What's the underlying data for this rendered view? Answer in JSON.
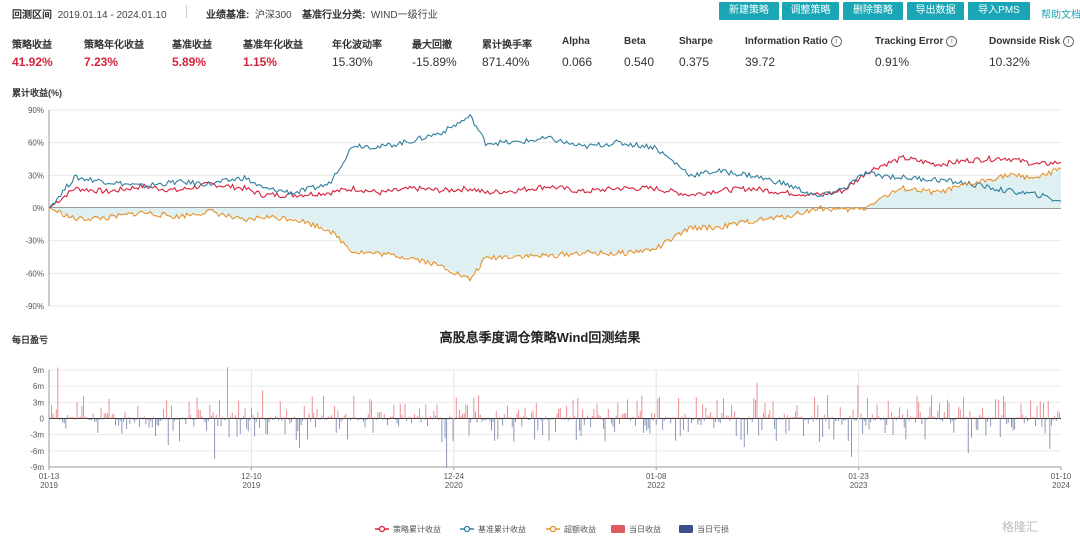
{
  "header": {
    "period_label": "回测区间",
    "period_value": "2019.01.14 - 2024.01.10",
    "benchmark_label": "业绩基准:",
    "benchmark_value": "沪深300",
    "industry_label": "基准行业分类:",
    "industry_value": "WIND一级行业",
    "buttons": [
      "新建策略",
      "调整策略",
      "删除策略",
      "导出数据",
      "导入PMS"
    ],
    "help": "帮助文档"
  },
  "metrics": [
    {
      "label": "策略收益",
      "value": "41.92%",
      "red": true
    },
    {
      "label": "策略年化收益",
      "value": "7.23%",
      "red": true
    },
    {
      "label": "基准收益",
      "value": "5.89%",
      "red": true
    },
    {
      "label": "基准年化收益",
      "value": "1.15%",
      "red": true
    },
    {
      "label": "年化波动率",
      "value": "15.30%",
      "red": false
    },
    {
      "label": "最大回撤",
      "value": "-15.89%",
      "red": false
    },
    {
      "label": "累计换手率",
      "value": "871.40%",
      "red": false
    },
    {
      "label": "Alpha",
      "value": "0.066",
      "red": false
    },
    {
      "label": "Beta",
      "value": "0.540",
      "red": false
    },
    {
      "label": "Sharpe",
      "value": "0.375",
      "red": false
    },
    {
      "label": "Information Ratio",
      "value": "39.72",
      "red": false,
      "info": true
    },
    {
      "label": "Tracking Error",
      "value": "0.91%",
      "red": false,
      "info": true
    },
    {
      "label": "Downside Risk",
      "value": "10.32%",
      "red": false,
      "info": true
    }
  ],
  "colors": {
    "button": "#1aa6b5",
    "strategy": "#d6233c",
    "benchmark": "#2f7f9e",
    "excess": "#e8922d",
    "daily_gain": "#e05a62",
    "daily_loss": "#3c4f86",
    "excess_fill": "#dff0f2"
  },
  "chart_data": [
    {
      "type": "line",
      "ylabel": "累计收益(%)",
      "ylim": [
        -90,
        90
      ],
      "yticks": [
        "90%",
        "60%",
        "30%",
        "0%",
        "-30%",
        "-60%",
        "-90%"
      ],
      "x": [
        "2019-01-14",
        "2019-03-01",
        "2019-05-01",
        "2019-07-01",
        "2019-09-01",
        "2019-11-01",
        "2020-01-01",
        "2020-02-03",
        "2020-04-01",
        "2020-06-01",
        "2020-07-15",
        "2020-09-01",
        "2020-11-01",
        "2020-12-24",
        "2021-02-10",
        "2021-02-18",
        "2021-03-10",
        "2021-05-01",
        "2021-07-01",
        "2021-09-01",
        "2021-11-01",
        "2022-01-08",
        "2022-03-15",
        "2022-05-01",
        "2022-07-01",
        "2022-09-01",
        "2022-10-31",
        "2022-12-15",
        "2023-01-23",
        "2023-02-15",
        "2023-04-01",
        "2023-06-01",
        "2023-08-01",
        "2023-10-01",
        "2023-12-01",
        "2024-01-10"
      ],
      "series": [
        {
          "name": "策略累计收益",
          "values": [
            0,
            18,
            15,
            20,
            16,
            22,
            18,
            12,
            12,
            14,
            18,
            14,
            18,
            16,
            18,
            17,
            14,
            16,
            20,
            15,
            18,
            18,
            12,
            16,
            18,
            14,
            12,
            16,
            32,
            38,
            46,
            40,
            44,
            46,
            40,
            42
          ]
        },
        {
          "name": "基准累计收益",
          "values": [
            0,
            28,
            24,
            20,
            24,
            22,
            28,
            18,
            14,
            22,
            58,
            56,
            62,
            70,
            84,
            78,
            60,
            60,
            64,
            56,
            60,
            56,
            30,
            34,
            30,
            22,
            10,
            18,
            32,
            30,
            28,
            26,
            22,
            16,
            12,
            6
          ]
        },
        {
          "name": "超额收益",
          "values": [
            0,
            -10,
            -9,
            -4,
            -8,
            -3,
            -12,
            -8,
            -10,
            -20,
            -40,
            -42,
            -46,
            -54,
            -66,
            -60,
            -46,
            -44,
            -44,
            -41,
            -42,
            -38,
            -18,
            -18,
            -12,
            -8,
            0,
            -2,
            0,
            8,
            18,
            14,
            22,
            30,
            28,
            36
          ]
        }
      ]
    },
    {
      "type": "bar",
      "ylabel": "每日盈亏",
      "ylim": [
        -9,
        9
      ],
      "yticks": [
        "9m",
        "6m",
        "3m",
        "0",
        "-3m",
        "-6m",
        "-9m"
      ],
      "xticks": [
        {
          "date": "01-13",
          "year": "2019"
        },
        {
          "date": "12-10",
          "year": "2019"
        },
        {
          "date": "12-24",
          "year": "2020"
        },
        {
          "date": "01-08",
          "year": "2022"
        },
        {
          "date": "01-23",
          "year": "2023"
        },
        {
          "date": "01-10",
          "year": "2024"
        }
      ],
      "series": [
        {
          "name": "当日收益"
        },
        {
          "name": "当日亏损"
        }
      ]
    }
  ],
  "main_title": "高股息季度调仓策略Wind回测结果",
  "legend": [
    "策略累计收益",
    "基准累计收益",
    "超额收益",
    "当日收益",
    "当日亏损"
  ],
  "watermark": "格隆汇"
}
